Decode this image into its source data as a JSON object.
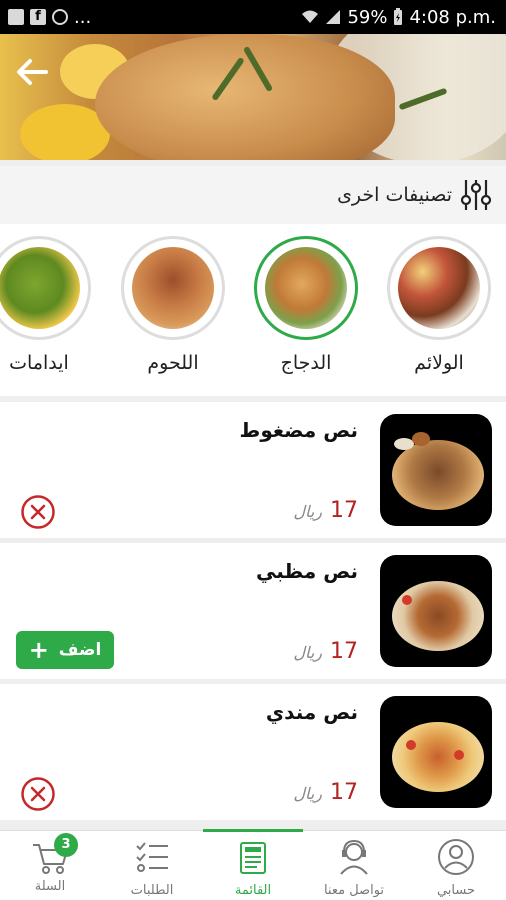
{
  "status_bar": {
    "left_more": "...",
    "battery": "59%",
    "time": "4:08 p.m."
  },
  "categories_section": {
    "title": "تصنيفات اخرى",
    "items": [
      {
        "label": "الولائم",
        "selected": false
      },
      {
        "label": "الدجاج",
        "selected": true
      },
      {
        "label": "اللحوم",
        "selected": false
      },
      {
        "label": "ايدامات",
        "selected": false
      }
    ]
  },
  "menu_items": [
    {
      "name": "نص مضغوط",
      "price": "17",
      "currency": "ريال",
      "in_cart": true
    },
    {
      "name": "نص مظبي",
      "price": "17",
      "currency": "ريال",
      "in_cart": false,
      "add_label": "اضف"
    },
    {
      "name": "نص مندي",
      "price": "17",
      "currency": "ريال",
      "in_cart": true
    }
  ],
  "bottom_nav": {
    "items": [
      {
        "label": "حسابي",
        "icon": "user-avatar-icon"
      },
      {
        "label": "تواصل معنا",
        "icon": "support-agent-icon"
      },
      {
        "label": "القائمة",
        "icon": "menu-board-icon",
        "active": true
      },
      {
        "label": "الطلبات",
        "icon": "checklist-icon"
      },
      {
        "label": "السلة",
        "icon": "cart-icon",
        "badge": "3"
      }
    ]
  },
  "colors": {
    "accent": "#2eaa48",
    "price": "#b22222",
    "remove": "#c62828"
  }
}
